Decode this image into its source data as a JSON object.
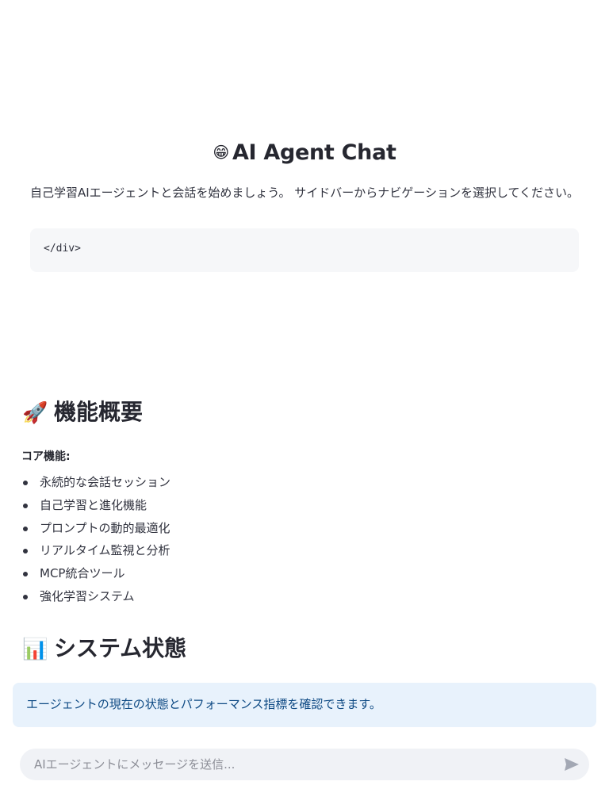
{
  "header": {
    "title_icon": "robot-face-icon",
    "title_emoji": "😁",
    "title": "AI Agent Chat"
  },
  "intro_text": "自己学習AIエージェントと会話を始めましょう。 サイドバーからナビゲーションを選択してください。",
  "code_block_text": "</div>",
  "features_section": {
    "icon": "rocket-icon",
    "emoji": "🚀",
    "heading": "機能概要",
    "core_label": "コア機能:",
    "items": [
      "永続的な会話セッション",
      "自己学習と進化機能",
      "プロンプトの動的最適化",
      "リアルタイム監視と分析",
      "MCP統合ツール",
      "強化学習システム"
    ]
  },
  "status_section": {
    "icon": "bar-chart-icon",
    "emoji": "📊",
    "heading": "システム状態",
    "info_text": "エージェントの現在の状態とパフォーマンス指標を確認できます。"
  },
  "chat_input": {
    "placeholder": "AIエージェントにメッセージを送信...",
    "value": "",
    "send_icon": "send-icon"
  },
  "colors": {
    "info_background": "#e8f2fc",
    "info_text": "#0e4a84",
    "code_background": "#f6f7f9",
    "input_background": "#f0f2f6"
  }
}
